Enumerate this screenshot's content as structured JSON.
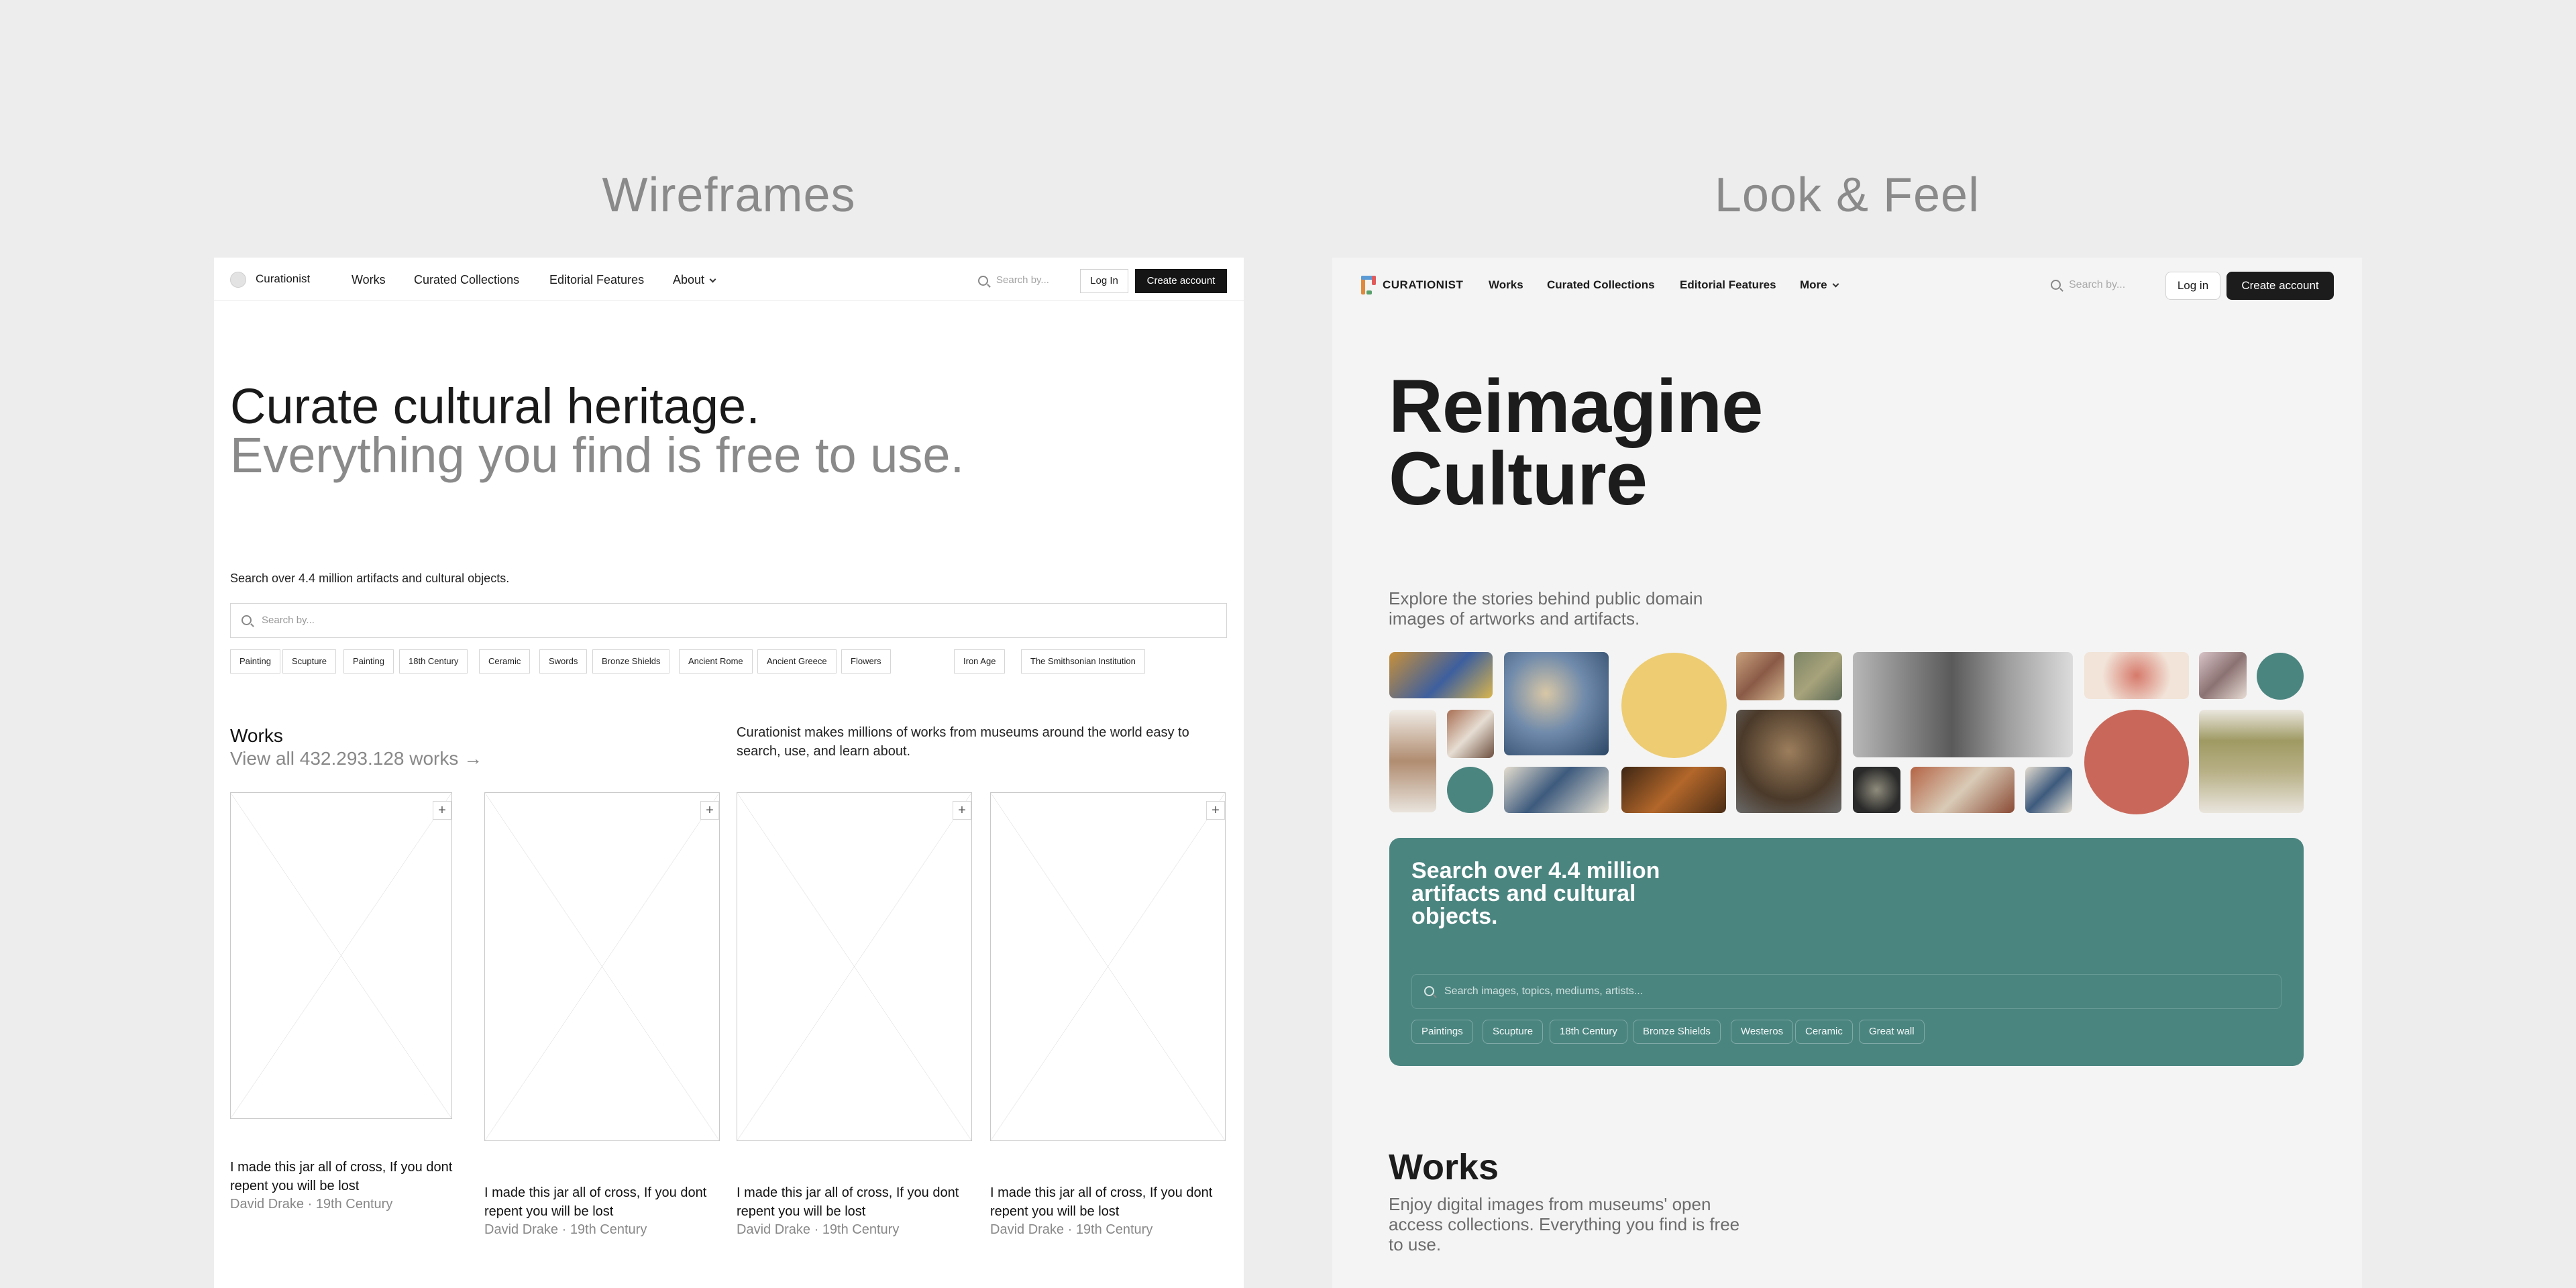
{
  "headings": {
    "left": "Wireframes",
    "right": "Look & Feel"
  },
  "wireframe": {
    "nav": {
      "brand": "Curationist",
      "items": [
        "Works",
        "Curated Collections",
        "Editorial Features",
        "About"
      ],
      "search_placeholder": "Search by...",
      "login": "Log In",
      "create_account": "Create account"
    },
    "hero": {
      "line1": "Curate cultural heritage.",
      "line2": "Everything you find is free to use."
    },
    "search": {
      "label": "Search over 4.4 million artifacts and cultural objects.",
      "placeholder": "Search by...",
      "tags": [
        "Painting",
        "Scupture",
        "Painting",
        "18th Century",
        "Ceramic",
        "Swords",
        "Bronze Shields",
        "Ancient Rome",
        "Ancient Greece",
        "Flowers",
        "Iron Age",
        "The Smithsonian Institution"
      ]
    },
    "works": {
      "title": "Works",
      "view_all": "View all 432.293.128 works →",
      "description": "Curationist makes millions of works from museums around the world easy to search, use, and learn about.",
      "cards": [
        {
          "title": "I made this jar all of cross, If you dont repent you will be lost",
          "meta": "David Drake · 19th Century"
        },
        {
          "title": "I made this jar all of cross, If you dont repent you will be lost",
          "meta": "David Drake · 19th Century"
        },
        {
          "title": "I made this jar all of cross, If you dont repent you will be lost",
          "meta": "David Drake · 19th Century"
        },
        {
          "title": "I made this jar all of cross, If you dont repent you will be lost",
          "meta": "David Drake · 19th Century"
        }
      ]
    }
  },
  "lookfeel": {
    "nav": {
      "brand": "CURATIONIST",
      "items": [
        "Works",
        "Curated Collections",
        "Editorial Features",
        "More"
      ],
      "search_placeholder": "Search by...",
      "login": "Log in",
      "create_account": "Create account"
    },
    "hero": {
      "title_line1": "Reimagine",
      "title_line2": "Culture",
      "subtitle": "Explore the stories behind public domain images of artworks and artifacts."
    },
    "search": {
      "title": "Search over 4.4 million artifacts and cultural objects.",
      "placeholder": "Search images, topics, mediums, artists...",
      "tags": [
        "Paintings",
        "Scupture",
        "18th Century",
        "Bronze Shields",
        "Westeros",
        "Ceramic",
        "Great wall"
      ]
    },
    "works": {
      "title": "Works",
      "description": "Enjoy digital images from museums' open access collections. Everything you find is free to use."
    },
    "colors": {
      "teal": "#4b8580",
      "yellow": "#edcc72",
      "coral": "#c9685a",
      "dark": "#1c1c1c"
    }
  }
}
